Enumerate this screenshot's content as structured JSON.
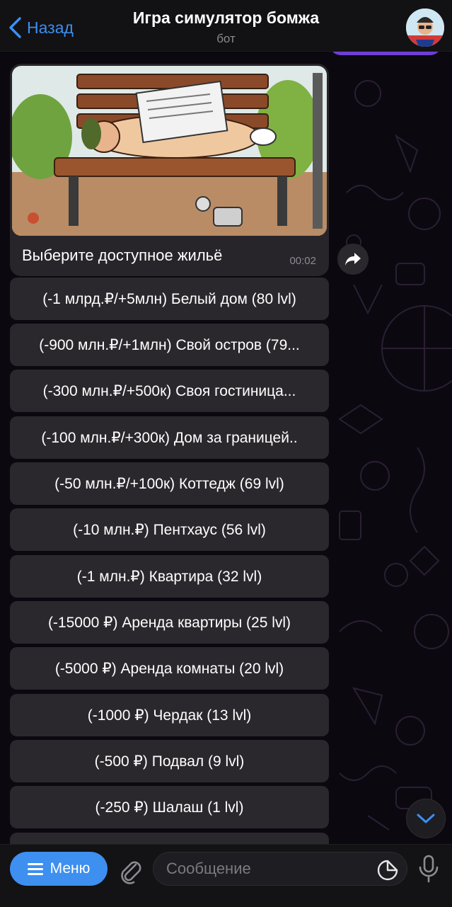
{
  "header": {
    "back_label": "Назад",
    "title": "Игра симулятор бомжа",
    "subtitle": "бот"
  },
  "message": {
    "caption": "Выберите доступное жильё",
    "time": "00:02"
  },
  "keyboard": {
    "buttons": [
      "(-1 млрд.₽/+5млн) Белый дом (80 lvl)",
      "(-900 млн.₽/+1млн) Свой остров (79...",
      "(-300 млн.₽/+500к) Своя гостиница...",
      "(-100 млн.₽/+300к) Дом за границей..",
      "(-50 млн.₽/+100к) Коттедж (69 lvl)",
      "(-10 млн.₽) Пентхаус (56 lvl)",
      "(-1 млн.₽) Квартира (32 lvl)",
      "(-15000 ₽) Аренда квартиры (25 lvl)",
      "(-5000 ₽) Аренда комнаты (20 lvl)",
      "(-1000 ₽) Чердак (13 lvl)",
      "(-500 ₽) Подвал (9 lvl)",
      "(-250 ₽) Шалаш (1 lvl)",
      ""
    ]
  },
  "input": {
    "menu_label": "Меню",
    "placeholder": "Сообщение"
  },
  "icons": {
    "back": "chevron-left-icon",
    "share": "share-icon",
    "scroll": "chevron-down-icon",
    "menu": "hamburger-icon",
    "attach": "paperclip-icon",
    "sticker": "sticker-icon",
    "mic": "microphone-icon"
  },
  "colors": {
    "accent": "#3d8ff0",
    "background": "#0c0810",
    "button": "#2b282d",
    "purple_bubble": "#6d3fd6"
  }
}
